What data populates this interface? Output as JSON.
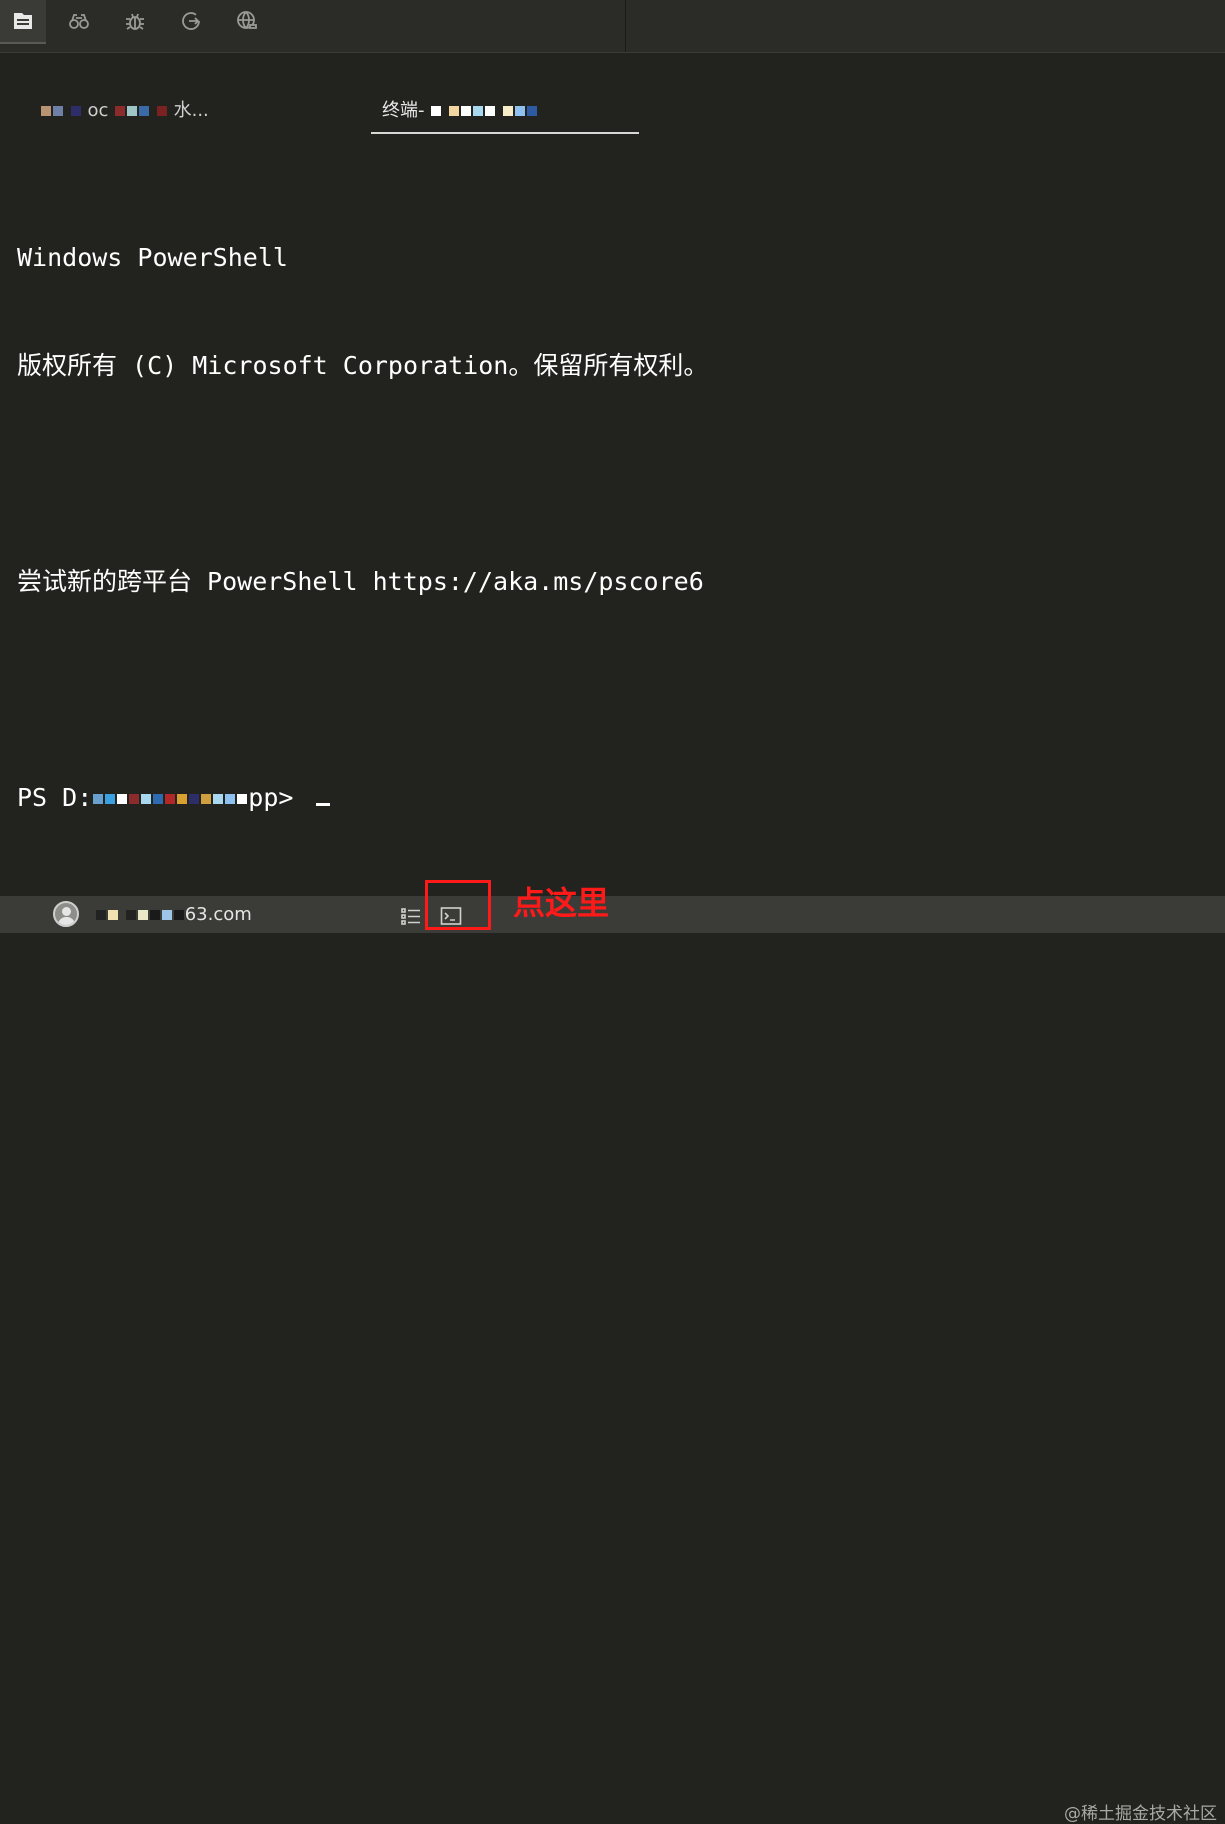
{
  "toolbar": {
    "buttons": [
      {
        "name": "explorer-icon"
      },
      {
        "name": "search-binoculars-icon"
      },
      {
        "name": "debug-bug-icon"
      },
      {
        "name": "source-control-icon"
      },
      {
        "name": "remote-globe-icon"
      }
    ]
  },
  "tabs": {
    "inactive_label": "oc",
    "inactive_suffix": "水...",
    "active_label": "终端-"
  },
  "terminal": {
    "lines": [
      "Windows PowerShell",
      "版权所有 (C) Microsoft Corporation。保留所有权利。",
      "",
      "尝试新的跨平台 PowerShell https://aka.ms/pscore6",
      "",
      "PS D:"
    ],
    "prompt_suffix": "pp> "
  },
  "statusbar": {
    "email_suffix": "63.com"
  },
  "annotation": {
    "text": "点这里",
    "color": "#ff1a1a"
  },
  "watermark": "@稀土掘金技术社区",
  "colors": {
    "background": "#22231f",
    "topbar": "#2b2b28",
    "statusbar": "#3b3b38"
  }
}
